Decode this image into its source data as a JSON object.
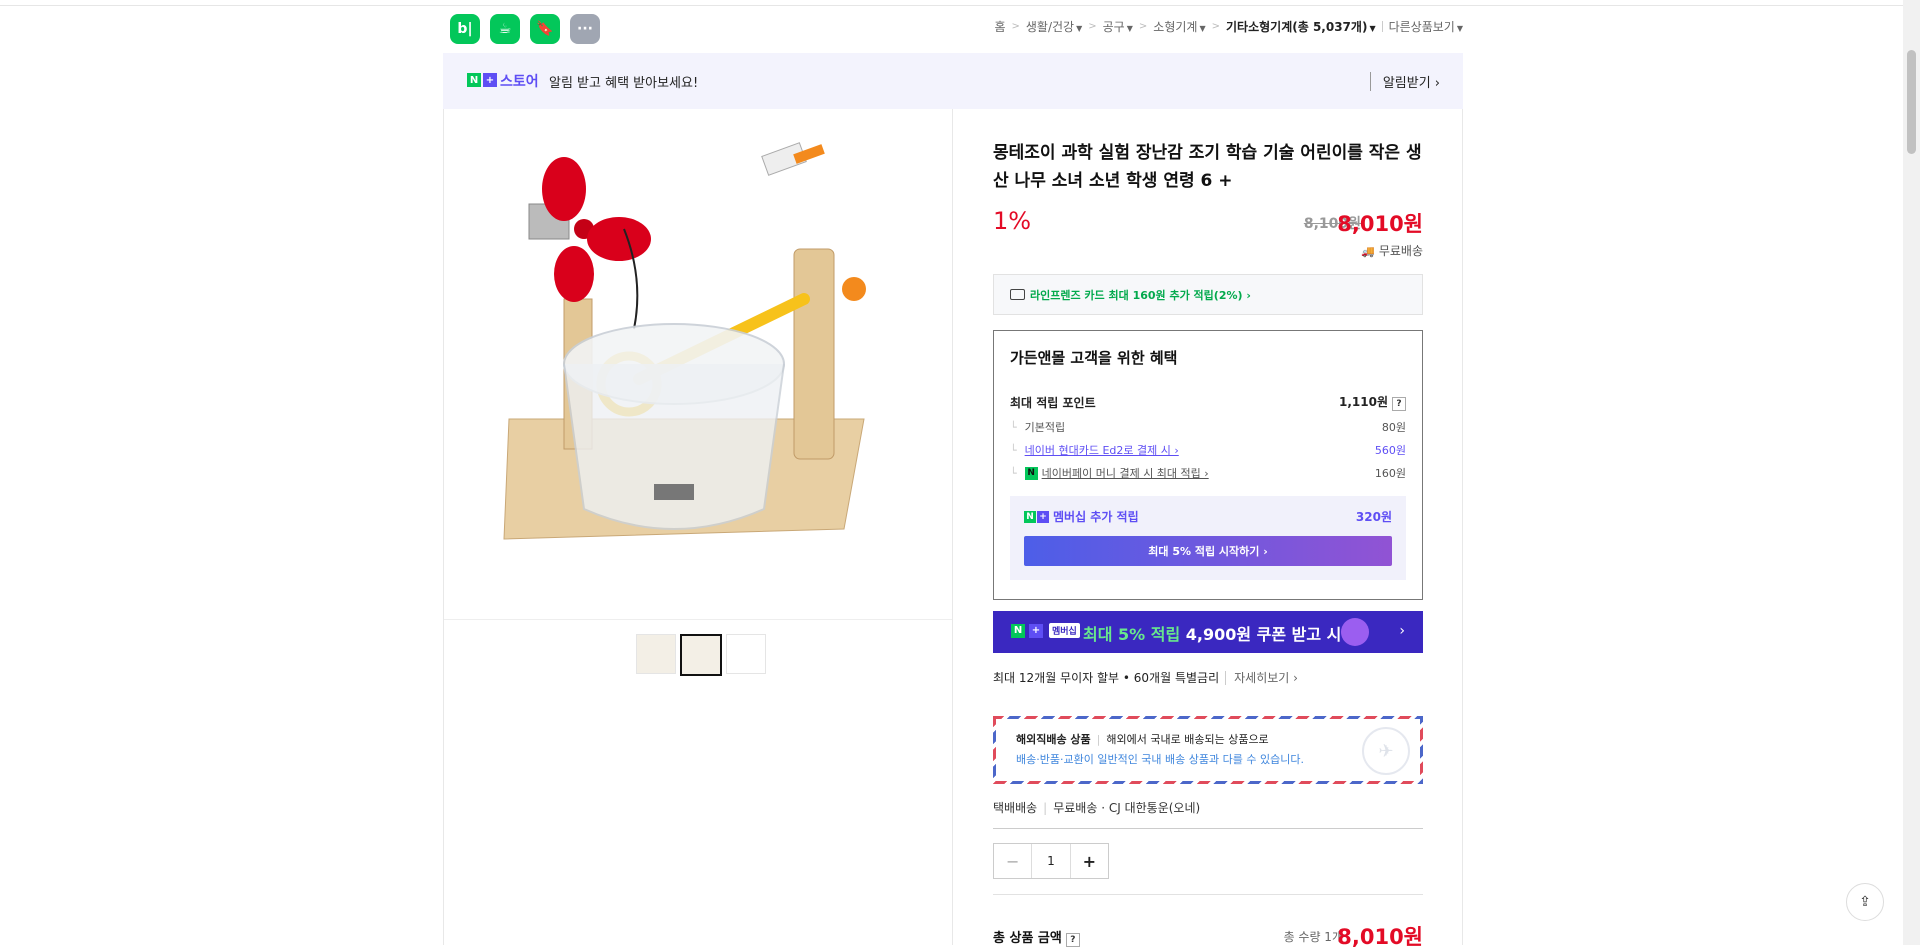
{
  "header": {
    "apps": [
      "b|",
      "☕",
      "🔖",
      "···"
    ],
    "breadcrumbs": [
      "홈",
      "생활/건강",
      "공구",
      "소형기계",
      "기타소형기계(총 5,037개)",
      "다른상품보기"
    ]
  },
  "notice": {
    "store": "스토어",
    "text": "알림 받고 혜택 받아보세요!",
    "alarm": "알림받기 ›"
  },
  "product": {
    "title": "몽테조이 과학 실험 장난감 조기 학습 기술 어린이를 작은 생산 나무 소녀 소년 학생 연령 6 +",
    "discount": "1%",
    "original_price": "8,100원",
    "final_price": "8,010원",
    "shipping": "무료배송"
  },
  "card_bar": {
    "text": "라인프렌즈 카드 최대 160원 추가 적립(2%) ›"
  },
  "benefit": {
    "title": "가든앤몰 고객을 위한 혜택",
    "max_points_label": "최대 적립 포인트",
    "max_points_value": "1,110원",
    "rows": [
      {
        "label": "기본적립",
        "value": "80원"
      },
      {
        "label": "네이버 현대카드 Ed2로 결제 시 ›",
        "value": "560원"
      },
      {
        "label": "네이버페이 머니 결제 시 최대 적립 ›",
        "value": "160원"
      }
    ],
    "membership_label": "멤버십 추가 적립",
    "membership_value": "320원",
    "start_button": "최대 5% 적립 시작하기 ›"
  },
  "banner": {
    "tag": "멤버십",
    "green": "최대 5% 적립",
    "white": " 4,900원 쿠폰 받고 시작",
    "arrow": "›"
  },
  "installment": {
    "text": "최대 12개월 무이자 할부 • 60개월 특별금리",
    "more": "자세히보기 ›"
  },
  "overseas": {
    "title": "해외직배송 상품",
    "text1": "해외에서 국내로 배송되는 상품으로",
    "text2": "배송·반품·교환이 일반적인 국내 배송 상품과 다를 수 있습니다."
  },
  "delivery": {
    "type": "택배배송",
    "fee": "무료배송",
    "carrier": "· CJ 대한통운(오네)"
  },
  "quantity": {
    "minus": "−",
    "value": "1",
    "plus": "+"
  },
  "total": {
    "label": "총 상품 금액",
    "qty": "총 수량 1개",
    "value": "8,010원"
  }
}
